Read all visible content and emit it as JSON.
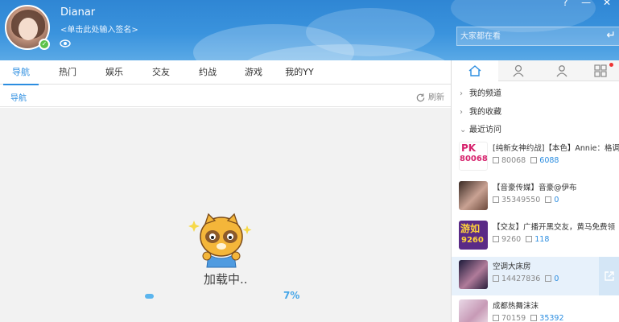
{
  "header": {
    "username": "Dianar",
    "signature": "<单击此处输入签名>",
    "search_placeholder": "大家都在看",
    "win_controls": [
      "?",
      "—",
      "✕"
    ]
  },
  "tabs": [
    "导航",
    "热门",
    "娱乐",
    "交友",
    "约战",
    "游戏",
    "我的YY"
  ],
  "subbar": {
    "title": "导航",
    "refresh_label": "刷新"
  },
  "loading": {
    "text": "加载中..",
    "percent_label": "7%",
    "progress": 0.07
  },
  "sidebar": {
    "tree": [
      "我的频道",
      "我的收藏",
      "最近访问"
    ],
    "channels": [
      {
        "title": "[纯新女神约战]【本色】Annie：格调的",
        "id": "80068",
        "fans": "6088"
      },
      {
        "title": "【音豪传媒】音豪@伊布",
        "id": "35349550",
        "fans": "0"
      },
      {
        "title": "【交友】广播开黑交友，黄马免费领",
        "id": "9260",
        "fans": "118"
      },
      {
        "title": "空调大床房",
        "id": "14427836",
        "fans": "0"
      },
      {
        "title": "成都热舞沫沫",
        "id": "70159",
        "fans": "35392"
      }
    ]
  },
  "colors": {
    "accent": "#2b8de0",
    "header": "#3a93dd",
    "content_bg": "#f2f2f2"
  }
}
